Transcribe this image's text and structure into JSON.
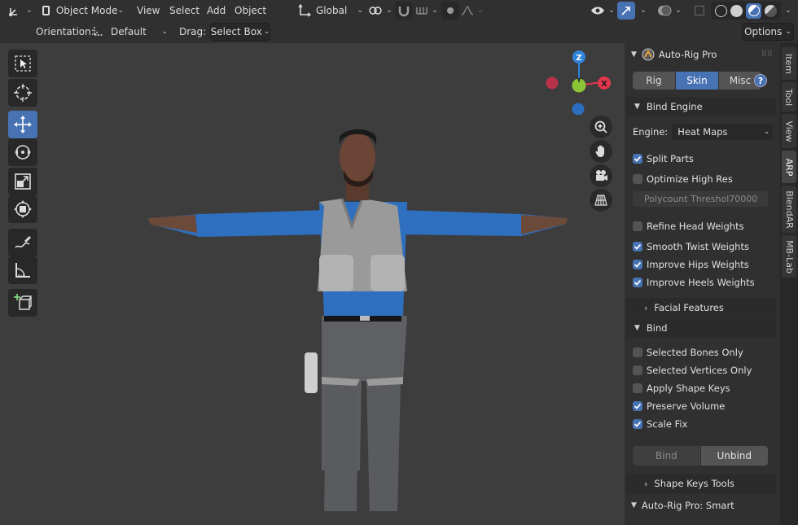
{
  "header": {
    "mode": "Object Mode",
    "menus": [
      "View",
      "Select",
      "Add",
      "Object"
    ],
    "transform_orientation": "Global",
    "orientation_label": "Orientation:",
    "orientation_value": "Default",
    "drag_label": "Drag:",
    "drag_value": "Select Box",
    "options_label": "Options"
  },
  "toolbar": {
    "tools": [
      "select-box-icon",
      "cursor-icon",
      "move-icon",
      "rotate-icon",
      "scale-icon",
      "transform-icon",
      "annotate-icon",
      "measure-icon",
      "add-cube-icon"
    ],
    "active_tool": "move-icon"
  },
  "gizmo": {
    "z_label": "Z",
    "y_label": "Y",
    "x_label": "X"
  },
  "panel": {
    "title": "Auto-Rig Pro",
    "tabs": [
      "Rig",
      "Skin",
      "Misc"
    ],
    "active_tab": "Skin",
    "help_label": "?",
    "bind_engine": {
      "title": "Bind Engine",
      "engine_label": "Engine:",
      "engine_value": "Heat Maps",
      "split_parts": "Split Parts",
      "optimize_high_res": "Optimize High Res",
      "polycount_label": "Polycount Threshol",
      "polycount_value": "70000",
      "refine_head": "Refine Head Weights",
      "smooth_twist": "Smooth Twist Weights",
      "improve_hips": "Improve Hips Weights",
      "improve_heels": "Improve Heels Weights"
    },
    "facial_features": "Facial Features",
    "bind": {
      "title": "Bind",
      "selected_bones": "Selected Bones Only",
      "selected_vertices": "Selected Vertices Only",
      "apply_shape_keys": "Apply Shape Keys",
      "preserve_volume": "Preserve Volume",
      "scale_fix": "Scale Fix",
      "bind_button": "Bind",
      "unbind_button": "Unbind"
    },
    "shape_keys_tools": "Shape Keys Tools",
    "smart": "Auto-Rig Pro: Smart"
  },
  "side_tabs": [
    "Item",
    "Tool",
    "View",
    "ARP",
    "BlendAR",
    "MB-Lab"
  ],
  "active_side_tab": "ARP",
  "colors": {
    "accent": "#4772b3",
    "axis_x": "#e4374c",
    "axis_y": "#8bc535",
    "axis_z": "#2f83db",
    "shirt": "#2e6fc0"
  }
}
